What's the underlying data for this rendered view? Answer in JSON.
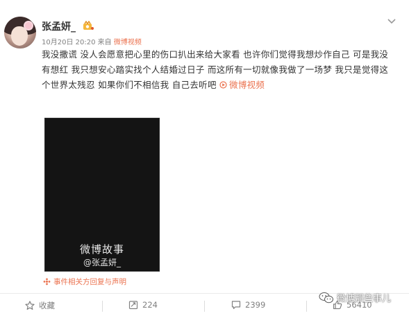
{
  "post": {
    "author_name": "张孟妍_",
    "date": "10月20日 20:20",
    "source_prefix": "来自",
    "source": "微博视频",
    "text": "我没撒谎 没人会愿意把心里的伤口扒出来给大家看  也许你们觉得我想炒作自己  可是我没有想红 我只想安心踏实找个人结婚过日子  而这所有一切就像我做了一场梦  我只是觉得这个世界太残忍  如果你们不相信我 自己去听吧 ",
    "link_text": "微博视频",
    "video": {
      "brand": "微博故事",
      "handle": "@张孟妍_"
    },
    "notice": "事件相关方回复与声明"
  },
  "actions": {
    "favorite_label": "收藏",
    "repost_count": "224",
    "comment_count": "2399",
    "like_count": "56410"
  },
  "watermark": "微博那些事儿",
  "colors": {
    "accent": "#eb7350",
    "text": "#333333",
    "meta": "#808080"
  }
}
